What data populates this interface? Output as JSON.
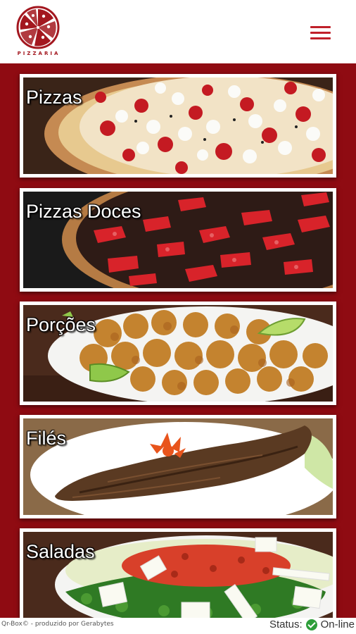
{
  "header": {
    "logo_text": "PIZZARIA",
    "menu_icon": "hamburger-menu-icon"
  },
  "categories": [
    {
      "label": "Pizzas",
      "image": "pizza-tomato-mozzarella"
    },
    {
      "label": "Pizzas Doces",
      "image": "chocolate-strawberry-pizza"
    },
    {
      "label": "Porções",
      "image": "fried-chicken-portion"
    },
    {
      "label": "Filés",
      "image": "grilled-steak"
    },
    {
      "label": "Saladas",
      "image": "salad-platter"
    }
  ],
  "footer": {
    "credit": "Qr-Box© - produzido por Gerabytes",
    "status_label": "Status:",
    "status_value": "On-line",
    "status_icon": "check-circle-icon"
  },
  "colors": {
    "brand_red": "#8f0b12",
    "accent_red": "#c0202a",
    "status_green": "#2e9e3a"
  }
}
